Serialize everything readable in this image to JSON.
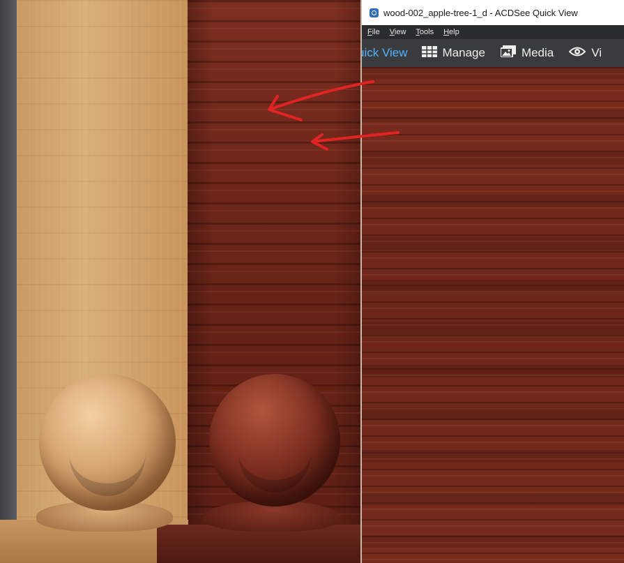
{
  "window": {
    "title": "wood-002_apple-tree-1_d - ACDSee Quick View",
    "icon": "camera-app-icon"
  },
  "menu": [
    {
      "label": "File",
      "mnemonic": "F",
      "rest": "ile"
    },
    {
      "label": "View",
      "mnemonic": "V",
      "rest": "iew"
    },
    {
      "label": "Tools",
      "mnemonic": "T",
      "rest": "ools"
    },
    {
      "label": "Help",
      "mnemonic": "H",
      "rest": "elp"
    }
  ],
  "modes": {
    "quick_view": {
      "label": "uick View",
      "active": true
    },
    "manage": {
      "label": "Manage",
      "icon": "grid-icon"
    },
    "media": {
      "label": "Media",
      "icon": "photos-icon"
    },
    "view": {
      "label": "Vi",
      "icon": "eye-icon"
    }
  },
  "colors": {
    "accent": "#55b3ff",
    "annotation": "#e02424",
    "light_wood": "#d2a673",
    "dark_wood": "#6a2418"
  }
}
